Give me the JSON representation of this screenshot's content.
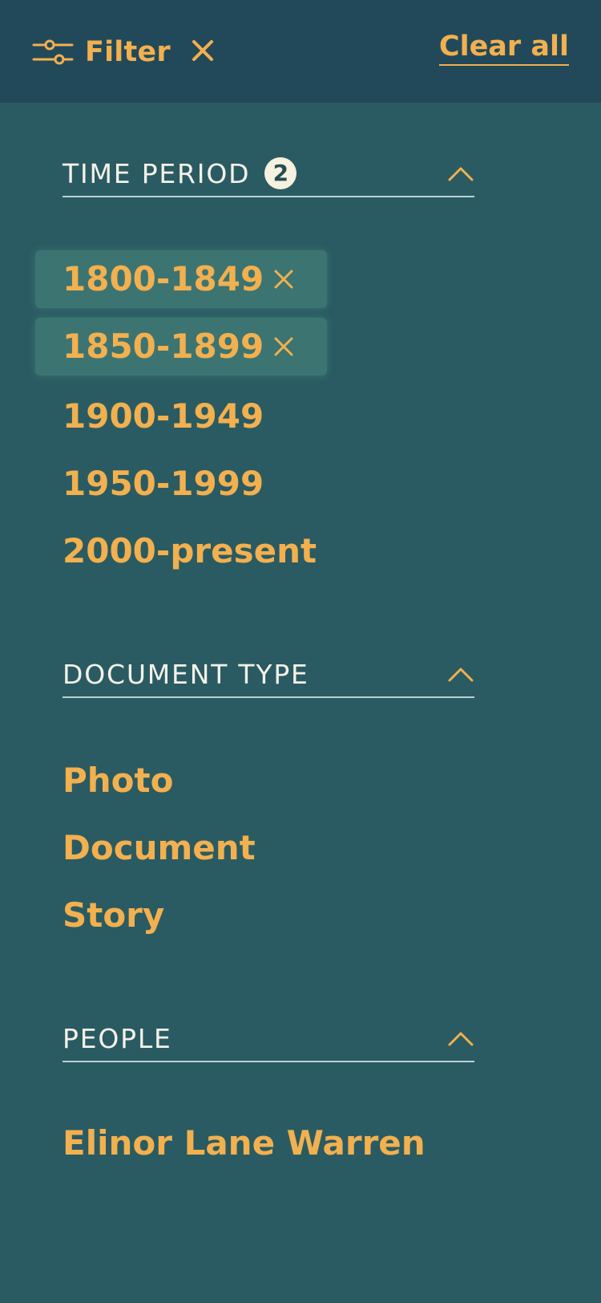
{
  "topbar": {
    "filter_label": "Filter",
    "clear_all_label": "Clear all"
  },
  "sections": [
    {
      "title": "TIME PERIOD",
      "badge": "2",
      "items": [
        {
          "label": "1800-1849",
          "selected": true
        },
        {
          "label": "1850-1899",
          "selected": true
        },
        {
          "label": "1900-1949",
          "selected": false
        },
        {
          "label": "1950-1999",
          "selected": false
        },
        {
          "label": "2000-present",
          "selected": false
        }
      ]
    },
    {
      "title": "DOCUMENT TYPE",
      "items": [
        {
          "label": "Photo"
        },
        {
          "label": "Document"
        },
        {
          "label": "Story"
        }
      ]
    },
    {
      "title": "PEOPLE",
      "items": [
        {
          "label": "Elinor Lane Warren"
        }
      ]
    }
  ],
  "icons": {
    "filter": "filter-sliders-icon",
    "close": "close-icon",
    "chevron": "chevron-up-icon",
    "remove": "remove-x-icon"
  },
  "colors": {
    "background": "#2a5b62",
    "topbar": "#22495a",
    "accent": "#f2b04f",
    "header_text": "#f4f1e9",
    "divider": "#b9d2d4",
    "selected_chip": "#3c7472",
    "badge_bg": "#f7f1df"
  }
}
